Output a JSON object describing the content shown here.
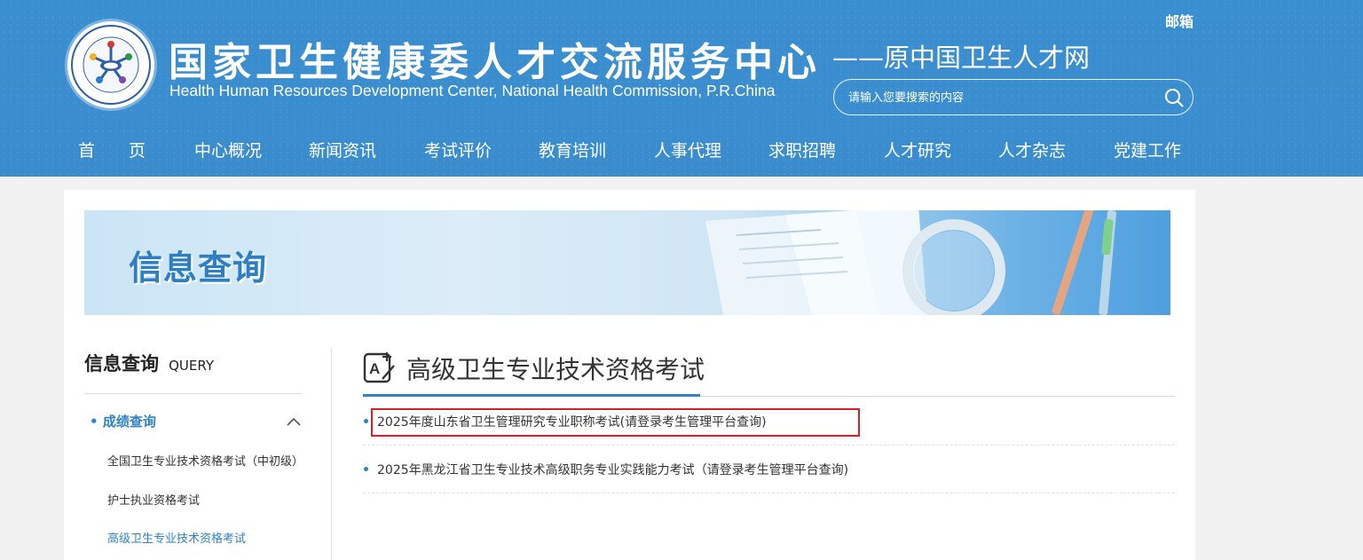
{
  "header": {
    "brand_cn": "国家卫生健康委人才交流服务中心",
    "brand_en": "Health Human Resources Development Center, National Health Commission, P.R.China",
    "brand_sub": "——原中国卫生人才网",
    "mail": "邮箱",
    "search_placeholder": "请输入您要搜索的内容"
  },
  "nav": {
    "items": [
      "首　　页",
      "中心概况",
      "新闻资讯",
      "考试评价",
      "教育培训",
      "人事代理",
      "求职招聘",
      "人才研究",
      "人才杂志",
      "党建工作"
    ]
  },
  "banner": {
    "title": "信息查询"
  },
  "sidebar": {
    "title_cn": "信息查询",
    "title_en": "QUERY",
    "category": "成绩查询",
    "items": [
      "全国卫生专业技术资格考试（中初级）",
      "护士执业资格考试",
      "高级卫生专业技术资格考试"
    ]
  },
  "main": {
    "title": "高级卫生专业技术资格考试",
    "list": [
      "2025年度山东省卫生管理研究专业职称考试(请登录考生管理平台查询)",
      "2025年黑龙江省卫生专业技术高级职务专业实践能力考试（请登录考生管理平台查询)"
    ]
  },
  "colors": {
    "header_blue": "#3a8ccd",
    "accent_blue": "#2f82c5",
    "highlight_red": "#d8202a"
  },
  "icons": [
    "logo-emblem",
    "search-icon",
    "chevron-up-icon",
    "edit-document-icon",
    "magnifier-illustration"
  ]
}
